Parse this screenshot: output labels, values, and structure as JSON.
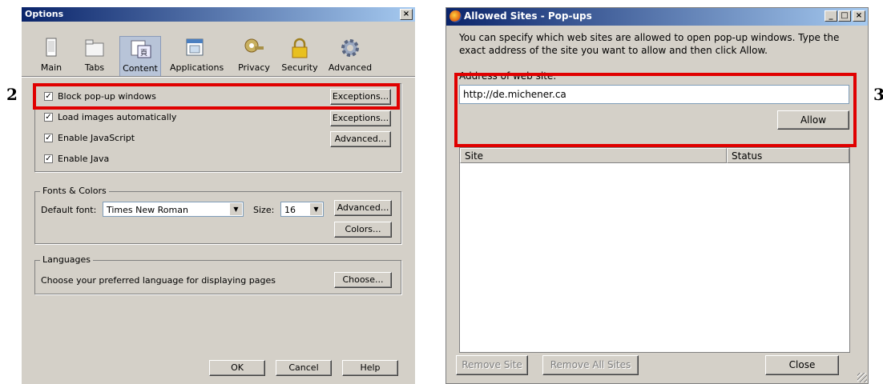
{
  "options": {
    "title": "Options",
    "close_label": "×",
    "tabs": [
      {
        "label": "Main",
        "icon": "main-icon"
      },
      {
        "label": "Tabs",
        "icon": "tabs-icon"
      },
      {
        "label": "Content",
        "icon": "content-icon"
      },
      {
        "label": "Applications",
        "icon": "applications-icon"
      },
      {
        "label": "Privacy",
        "icon": "privacy-icon"
      },
      {
        "label": "Security",
        "icon": "security-icon"
      },
      {
        "label": "Advanced",
        "icon": "advanced-icon"
      }
    ],
    "content": {
      "block_popups": {
        "label": "Block pop-up windows",
        "checked": true,
        "button": "Exceptions..."
      },
      "load_images": {
        "label": "Load images automatically",
        "checked": true,
        "button": "Exceptions..."
      },
      "enable_js": {
        "label": "Enable JavaScript",
        "checked": true,
        "button": "Advanced..."
      },
      "enable_java": {
        "label": "Enable Java",
        "checked": true
      }
    },
    "fonts": {
      "group_title": "Fonts & Colors",
      "default_font_label": "Default font:",
      "default_font_value": "Times New Roman",
      "size_label": "Size:",
      "size_value": "16",
      "advanced_button": "Advanced...",
      "colors_button": "Colors..."
    },
    "languages": {
      "group_title": "Languages",
      "description": "Choose your preferred language for displaying pages",
      "choose_button": "Choose..."
    },
    "footer": {
      "ok": "OK",
      "cancel": "Cancel",
      "help": "Help"
    }
  },
  "allowed_sites": {
    "title": "Allowed Sites - Pop-ups",
    "caption_buttons": [
      "_",
      "□",
      "×"
    ],
    "intro": "You can specify which web sites are allowed to open pop-up windows. Type the exact address of the site you want to allow and then click Allow.",
    "address_label": "Address of web site:",
    "address_value": "http://de.michener.ca",
    "allow_button": "Allow",
    "columns": [
      "Site",
      "Status"
    ],
    "remove_site": "Remove Site",
    "remove_all_sites": "Remove All Sites",
    "close_button": "Close"
  },
  "annotations": {
    "step_left": "2",
    "step_right": "3"
  },
  "colors": {
    "highlight": "#e00000",
    "titlebar": "#0a246a"
  }
}
